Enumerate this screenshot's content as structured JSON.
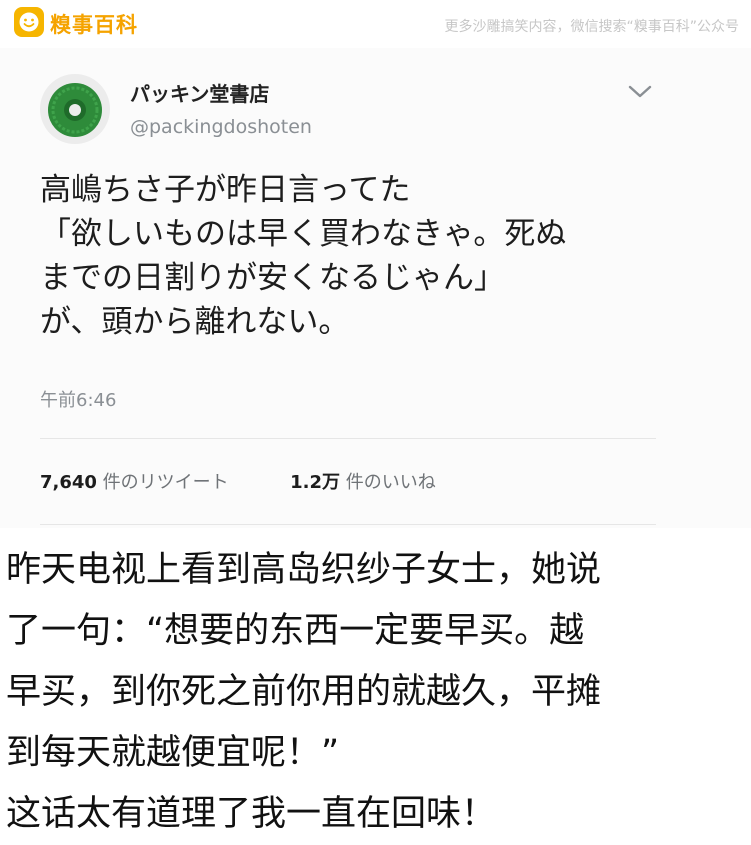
{
  "watermark": {
    "brand": "糗事百科",
    "tagline": "更多沙雕搞笑内容，微信搜索“糗事百科”公众号"
  },
  "tweet": {
    "display_name": "パッキン堂書店",
    "handle": "@packingdoshoten",
    "body_lines": [
      "高嶋ちさ子が昨日言ってた",
      "「欲しいものは早く買わなきゃ。死ぬ",
      "までの日割りが安くなるじゃん」",
      "が、頭から離れない。"
    ],
    "time": "午前6:46",
    "retweets_count": "7,640",
    "retweets_label": "件のリツイート",
    "likes_count": "1.2万",
    "likes_label": "件のいいね"
  },
  "caption_lines": [
    "昨天电视上看到高岛织纱子女士，她说",
    "了一句：“想要的东西一定要早买。越",
    "早买，到你死之前你用的就越久，平摊",
    "到每天就越便宜呢！”",
    "这话太有道理了我一直在回味！"
  ],
  "icons": {
    "brand_logo": "smiley-face-icon",
    "menu": "chevron-down-icon",
    "avatar": "green-ring-avatar"
  },
  "colors": {
    "brand": "#f6b500",
    "avatar_green": "#2e8b3a"
  }
}
